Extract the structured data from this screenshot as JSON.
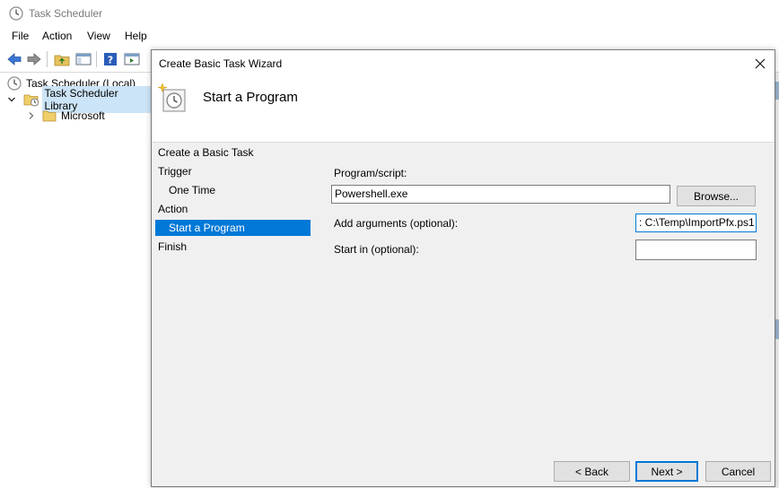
{
  "app": {
    "title": "Task Scheduler",
    "menu": [
      "File",
      "Action",
      "View",
      "Help"
    ]
  },
  "tree": {
    "items": [
      {
        "label": "Task Scheduler (Local)"
      },
      {
        "label": "Task Scheduler Library"
      },
      {
        "label": "Microsoft"
      }
    ]
  },
  "wizard": {
    "title": "Create Basic Task Wizard",
    "heading": "Start a Program",
    "steps": [
      {
        "label": "Create a Basic Task"
      },
      {
        "label": "Trigger"
      },
      {
        "label": "One Time"
      },
      {
        "label": "Action"
      },
      {
        "label": "Start a Program"
      },
      {
        "label": "Finish"
      }
    ],
    "program_label": "Program/script:",
    "program_value": "Powershell.exe",
    "browse_label": "Browse...",
    "args_label": "Add arguments (optional):",
    "args_value": ": C:\\Temp\\ImportPfx.ps1",
    "startin_label": "Start in (optional):",
    "startin_value": "",
    "back_label": "< Back",
    "next_label": "Next >",
    "cancel_label": "Cancel"
  },
  "colors": {
    "accent": "#0078d7",
    "selection_light": "#cce4f7",
    "body_bg": "#f0f0f0"
  }
}
